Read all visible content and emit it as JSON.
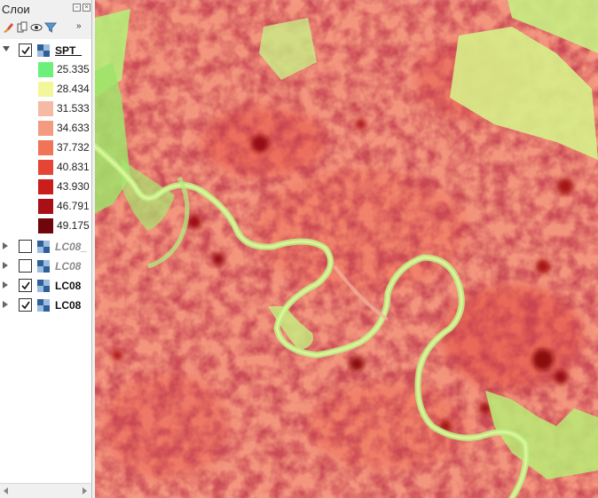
{
  "panel": {
    "title": "Слои",
    "buttons": [
      "float-button",
      "close-button"
    ],
    "toolbar": [
      "style-manager-icon",
      "add-group-icon",
      "visibility-icon",
      "filter-icon",
      "more-chevron-icon"
    ],
    "more_label": "»"
  },
  "layers": [
    {
      "name": "SPT_",
      "checked": true,
      "expanded": true,
      "legend": [
        {
          "label": "25.335",
          "color": "#6cf07a"
        },
        {
          "label": "28.434",
          "color": "#f3f79a"
        },
        {
          "label": "31.533",
          "color": "#f6b9a4"
        },
        {
          "label": "34.633",
          "color": "#f49a82"
        },
        {
          "label": "37.732",
          "color": "#f07457"
        },
        {
          "label": "40.831",
          "color": "#e64435"
        },
        {
          "label": "43.930",
          "color": "#cc1d1d"
        },
        {
          "label": "46.791",
          "color": "#a81016"
        },
        {
          "label": "49.175",
          "color": "#6e060b"
        }
      ]
    },
    {
      "name": "LC08_",
      "checked": false,
      "expanded": false
    },
    {
      "name": "LC08",
      "checked": false,
      "expanded": false
    },
    {
      "name": "LC08",
      "checked": true,
      "expanded": false
    },
    {
      "name": "LC08",
      "checked": true,
      "expanded": false
    }
  ],
  "map": {
    "description_colors": {
      "cool": "#9ff06a",
      "warm": "#f6a893",
      "hot": "#b3141b"
    }
  }
}
